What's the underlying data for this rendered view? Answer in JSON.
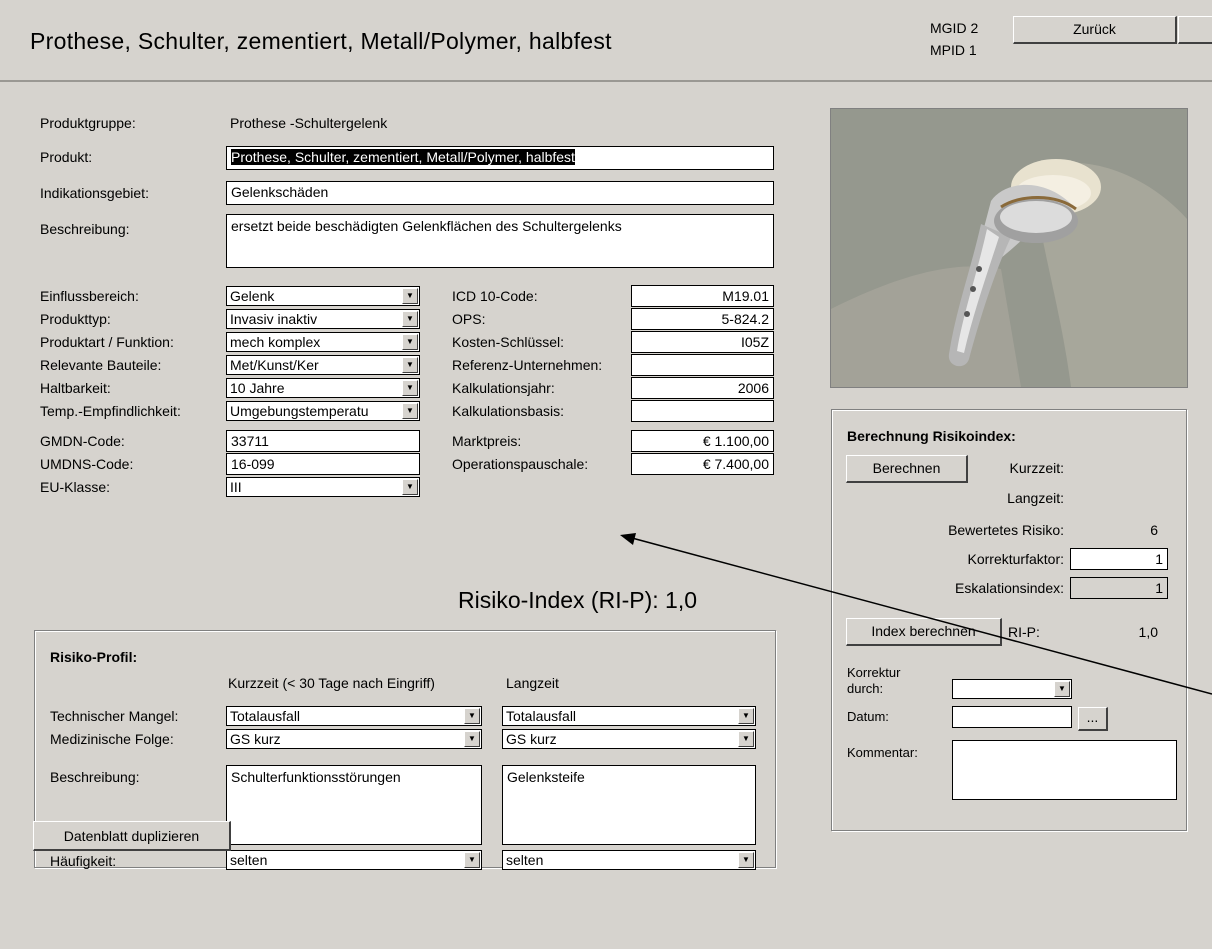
{
  "header": {
    "title": "Prothese, Schulter, zementiert, Metall/Polymer, halbfest",
    "mgid_label": "MGID",
    "mgid_value": "2",
    "mpid_label": "MPID",
    "mpid_value": "1",
    "back_button": "Zurück"
  },
  "product": {
    "group_label": "Produktgruppe:",
    "group_value": "Prothese -Schultergelenk",
    "product_label": "Produkt:",
    "product_value": "Prothese, Schulter, zementiert, Metall/Polymer, halbfest",
    "indication_label": "Indikationsgebiet:",
    "indication_value": "Gelenkschäden",
    "description_label": "Beschreibung:",
    "description_value": "ersetzt beide beschädigten Gelenkflächen des Schultergelenks"
  },
  "attributes": {
    "einfluss_label": "Einflussbereich:",
    "einfluss_value": "Gelenk",
    "produkttyp_label": "Produkttyp:",
    "produkttyp_value": "Invasiv inaktiv",
    "produktart_label": "Produktart / Funktion:",
    "produktart_value": "mech komplex",
    "bauteile_label": "Relevante Bauteile:",
    "bauteile_value": "Met/Kunst/Ker",
    "haltbarkeit_label": "Haltbarkeit:",
    "haltbarkeit_value": "10 Jahre",
    "temp_label": "Temp.-Empfindlichkeit:",
    "temp_value": "Umgebungstemperatu",
    "gmdn_label": "GMDN-Code:",
    "gmdn_value": "33711",
    "umdns_label": "UMDNS-Code:",
    "umdns_value": "16-099",
    "euklasse_label": "EU-Klasse:",
    "euklasse_value": "III"
  },
  "codes": {
    "icd_label": "ICD 10-Code:",
    "icd_value": "M19.01",
    "ops_label": "OPS:",
    "ops_value": "5-824.2",
    "kosten_label": "Kosten-Schlüssel:",
    "kosten_value": "I05Z",
    "referenz_label": "Referenz-Unternehmen:",
    "referenz_value": "",
    "kalkjahr_label": "Kalkulationsjahr:",
    "kalkjahr_value": "2006",
    "kalkbasis_label": "Kalkulationsbasis:",
    "kalkbasis_value": "",
    "marktpreis_label": "Marktpreis:",
    "marktpreis_value": "€ 1.100,00",
    "oppauschale_label": "Operationspauschale:",
    "oppauschale_value": "€ 7.400,00"
  },
  "risk_index": {
    "label": "Risiko-Index (RI-P):",
    "value": "1,0"
  },
  "risk_profile": {
    "title": "Risiko-Profil:",
    "short_header": "Kurzzeit (< 30 Tage nach Eingriff)",
    "long_header": "Langzeit",
    "tech_label": "Technischer Mangel:",
    "tech_short": "Totalausfall",
    "tech_long": "Totalausfall",
    "med_label": "Medizinische Folge:",
    "med_short": "GS kurz",
    "med_long": "GS kurz",
    "desc_label": "Beschreibung:",
    "desc_short": "Schulterfunktionsstörungen",
    "desc_long": "Gelenksteife",
    "freq_label": "Häufigkeit:",
    "freq_short": "selten",
    "freq_long": "selten"
  },
  "calc": {
    "title": "Berechnung Risikoindex:",
    "calc_button": "Berechnen",
    "kurzzeit_label": "Kurzzeit:",
    "langzeit_label": "Langzeit:",
    "bewertet_label": "Bewertetes Risiko:",
    "bewertet_value": "6",
    "korrektur_label": "Korrekturfaktor:",
    "korrektur_value": "1",
    "eskalation_label": "Eskalationsindex:",
    "eskalation_value": "1",
    "index_button": "Index berechnen",
    "rip_label": "RI-P:",
    "rip_value": "1,0",
    "korrektur_durch_label1": "Korrektur",
    "korrektur_durch_label2": "durch:",
    "korrektur_durch_value": "",
    "datum_label": "Datum:",
    "datum_value": "",
    "datum_button": "...",
    "kommentar_label": "Kommentar:",
    "kommentar_value": ""
  },
  "footer": {
    "duplicate_button": "Datenblatt duplizieren"
  }
}
